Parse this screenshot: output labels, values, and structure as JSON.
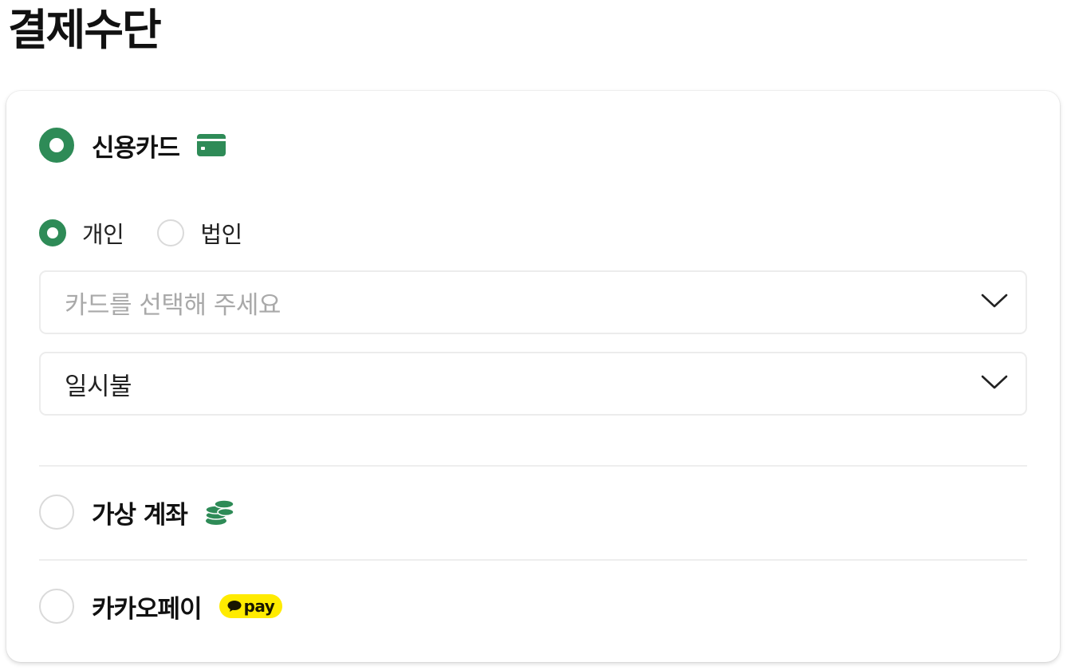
{
  "page": {
    "title": "결제수단"
  },
  "payment_methods": [
    {
      "label": "신용카드",
      "selected": true,
      "icon": "credit-card-icon",
      "icon_color": "#2e8b57"
    },
    {
      "label": "가상 계좌",
      "selected": false,
      "icon": "coins-icon",
      "icon_color": "#2e8b57"
    },
    {
      "label": "카카오페이",
      "selected": false,
      "icon": "kakaopay-badge",
      "badge_text": "pay",
      "badge_color": "#ffeb00"
    }
  ],
  "card_type": {
    "options": [
      {
        "label": "개인",
        "selected": true
      },
      {
        "label": "법인",
        "selected": false
      }
    ]
  },
  "card_select": {
    "placeholder": "카드를 선택해 주세요",
    "value": ""
  },
  "installment_select": {
    "value": "일시불"
  },
  "colors": {
    "accent": "#2e8b57",
    "placeholder": "#a9a9a9",
    "border": "#ececec",
    "kakao_yellow": "#ffeb00"
  }
}
